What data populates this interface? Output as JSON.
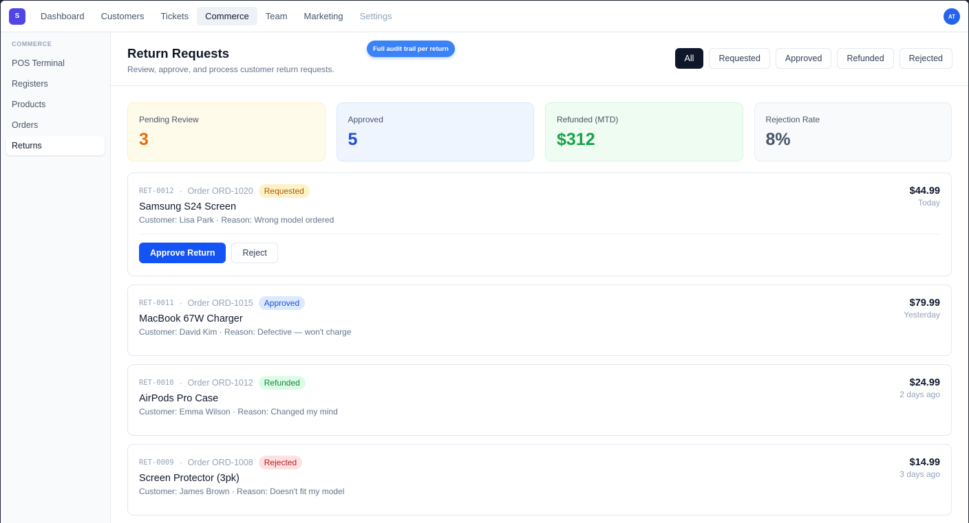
{
  "app": {
    "logo_letter": "S",
    "avatar_initials": "AT"
  },
  "nav": {
    "items": [
      {
        "label": "Dashboard"
      },
      {
        "label": "Customers"
      },
      {
        "label": "Tickets"
      },
      {
        "label": "Commerce"
      },
      {
        "label": "Team"
      },
      {
        "label": "Marketing"
      },
      {
        "label": "Settings"
      }
    ],
    "active": "Commerce"
  },
  "sidebar": {
    "heading": "COMMERCE",
    "items": [
      {
        "label": "POS Terminal"
      },
      {
        "label": "Registers"
      },
      {
        "label": "Products"
      },
      {
        "label": "Orders"
      },
      {
        "label": "Returns"
      }
    ],
    "active": "Returns"
  },
  "header": {
    "title": "Return Requests",
    "subtitle": "Review, approve, and process customer return requests.",
    "audit_pill": "Full audit trail per return",
    "filters": [
      {
        "label": "All"
      },
      {
        "label": "Requested"
      },
      {
        "label": "Approved"
      },
      {
        "label": "Refunded"
      },
      {
        "label": "Rejected"
      }
    ],
    "active_filter": "All"
  },
  "stats": [
    {
      "label": "Pending Review",
      "value": "3"
    },
    {
      "label": "Approved",
      "value": "5"
    },
    {
      "label": "Refunded (MTD)",
      "value": "$312"
    },
    {
      "label": "Rejection Rate",
      "value": "8%"
    }
  ],
  "returns": [
    {
      "id": "RET-0012",
      "order": "Order ORD-1020",
      "status": "Requested",
      "product": "Samsung S24 Screen",
      "detail": "Customer: Lisa Park · Reason: Wrong model ordered",
      "amount": "$44.99",
      "when": "Today",
      "actions": {
        "approve": "Approve Return",
        "reject": "Reject"
      }
    },
    {
      "id": "RET-0011",
      "order": "Order ORD-1015",
      "status": "Approved",
      "product": "MacBook 67W Charger",
      "detail": "Customer: David Kim · Reason: Defective — won't charge",
      "amount": "$79.99",
      "when": "Yesterday"
    },
    {
      "id": "RET-0010",
      "order": "Order ORD-1012",
      "status": "Refunded",
      "product": "AirPods Pro Case",
      "detail": "Customer: Emma Wilson · Reason: Changed my mind",
      "amount": "$24.99",
      "when": "2 days ago"
    },
    {
      "id": "RET-0009",
      "order": "Order ORD-1008",
      "status": "Rejected",
      "product": "Screen Protector (3pk)",
      "detail": "Customer: James Brown · Reason: Doesn't fit my model",
      "amount": "$14.99",
      "when": "3 days ago"
    }
  ],
  "colors": {
    "primary": "#1454f5",
    "pending": "#ea6a0c",
    "approved": "#1d4ed8",
    "refunded": "#16a34a",
    "rejected": "#b91c1c"
  }
}
